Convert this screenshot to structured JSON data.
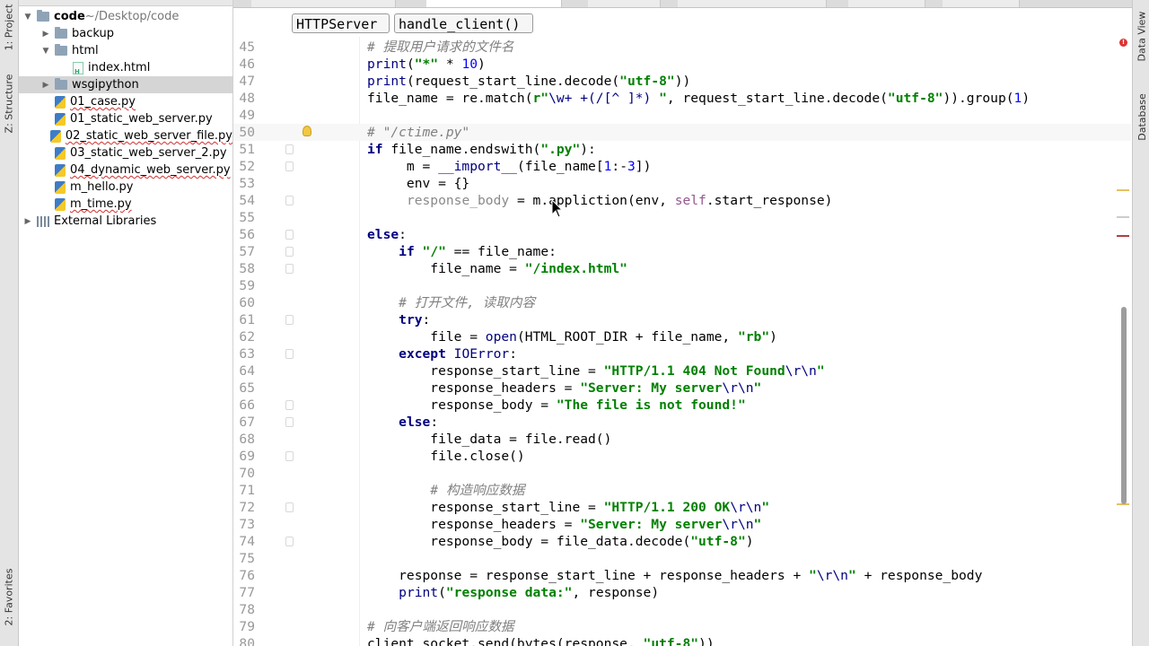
{
  "left_strip": {
    "project_tab": "1: Project",
    "structure_tab": "Z: Structure",
    "favorites_tab": "2: Favorites"
  },
  "right_strip": {
    "data_view_tab": "Data View",
    "database_tab": "Database"
  },
  "project_tree": [
    {
      "label": "code",
      "suffix": " ~/Desktop/code",
      "kind": "folder",
      "depth": 0,
      "expanded": true
    },
    {
      "label": "backup",
      "kind": "folder",
      "depth": 1,
      "expanded": false
    },
    {
      "label": "html",
      "kind": "folder",
      "depth": 1,
      "expanded": true
    },
    {
      "label": "index.html",
      "kind": "html",
      "depth": 2
    },
    {
      "label": "wsgipython",
      "kind": "folder",
      "depth": 1,
      "expanded": false,
      "selected": true
    },
    {
      "label": "01_case.py",
      "kind": "py",
      "depth": 1,
      "error": true
    },
    {
      "label": "01_static_web_server.py",
      "kind": "py",
      "depth": 1,
      "error": false
    },
    {
      "label": "02_static_web_server_file.py",
      "kind": "py",
      "depth": 1,
      "error": true
    },
    {
      "label": "03_static_web_server_2.py",
      "kind": "py",
      "depth": 1,
      "error": false
    },
    {
      "label": "04_dynamic_web_server.py",
      "kind": "py",
      "depth": 1,
      "error": true
    },
    {
      "label": "m_hello.py",
      "kind": "py",
      "depth": 1,
      "error": false
    },
    {
      "label": "m_time.py",
      "kind": "py",
      "depth": 1,
      "error": true
    },
    {
      "label": "External Libraries",
      "kind": "lib",
      "depth": 0,
      "expanded": false
    }
  ],
  "breadcrumb": {
    "class_name": "HTTPServer",
    "method_name": "handle_client()"
  },
  "code_lines": [
    {
      "n": "45",
      "html": "<span class='c-cm'># 提取用户请求的文件名</span>"
    },
    {
      "n": "46",
      "html": "<span class='c-bi'>print</span>(<span class='c-str'>\"*\"</span> * <span class='c-num'>10</span>)"
    },
    {
      "n": "47",
      "html": "<span class='c-bi'>print</span>(request_start_line.decode(<span class='c-str'>\"utf-8\"</span>))"
    },
    {
      "n": "48",
      "html": "file_name = re.match(<span class='c-str'>r\"</span><span class='c-esc'>\\w+ +(/[^ ]*) </span><span class='c-str'>\"</span>, request_start_line.decode(<span class='c-str'>\"utf-8\"</span>)).group(<span class='c-num'>1</span>)"
    },
    {
      "n": "49",
      "html": ""
    },
    {
      "n": "50",
      "html": "<span class='c-cm'># \"/ctime.py\"</span>",
      "current": true
    },
    {
      "n": "51",
      "html": "<span class='c-kw'>if</span> file_name.endswith(<span class='c-str'>\".py\"</span>):"
    },
    {
      "n": "52",
      "html": "     m = <span class='c-bi'>__import__</span>(file_name[<span class='c-num'>1</span>:-<span class='c-num'>3</span>])"
    },
    {
      "n": "53",
      "html": "     env = {}"
    },
    {
      "n": "54",
      "html": "     <span class='c-dim'>response_body</span> = m.appliction(env, <span class='c-self'>self</span>.start_response)"
    },
    {
      "n": "55",
      "html": ""
    },
    {
      "n": "56",
      "html": "<span class='c-kw'>else</span>:"
    },
    {
      "n": "57",
      "html": "    <span class='c-kw'>if</span> <span class='c-str'>\"/\"</span> == file_name:"
    },
    {
      "n": "58",
      "html": "        file_name = <span class='c-str'>\"/index.html\"</span>"
    },
    {
      "n": "59",
      "html": ""
    },
    {
      "n": "60",
      "html": "    <span class='c-cm'># 打开文件, 读取内容</span>"
    },
    {
      "n": "61",
      "html": "    <span class='c-kw'>try</span>:"
    },
    {
      "n": "62",
      "html": "        file = <span class='c-bi'>open</span>(HTML_ROOT_DIR + file_name, <span class='c-str'>\"rb\"</span>)"
    },
    {
      "n": "63",
      "html": "    <span class='c-kw'>except</span> <span class='c-bi'>IOError</span>:"
    },
    {
      "n": "64",
      "html": "        response_start_line = <span class='c-str'>\"HTTP/1.1 404 Not Found</span><span class='c-esc'>\\r\\n</span><span class='c-str'>\"</span>"
    },
    {
      "n": "65",
      "html": "        response_headers = <span class='c-str'>\"Server: My server</span><span class='c-esc'>\\r\\n</span><span class='c-str'>\"</span>"
    },
    {
      "n": "66",
      "html": "        response_body = <span class='c-str'>\"The file is not found!\"</span>"
    },
    {
      "n": "67",
      "html": "    <span class='c-kw'>else</span>:"
    },
    {
      "n": "68",
      "html": "        file_data = file.read()"
    },
    {
      "n": "69",
      "html": "        file.close()"
    },
    {
      "n": "70",
      "html": ""
    },
    {
      "n": "71",
      "html": "        <span class='c-cm'># 构造响应数据</span>"
    },
    {
      "n": "72",
      "html": "        response_start_line = <span class='c-str'>\"HTTP/1.1 200 OK</span><span class='c-esc'>\\r\\n</span><span class='c-str'>\"</span>"
    },
    {
      "n": "73",
      "html": "        response_headers = <span class='c-str'>\"Server: My server</span><span class='c-esc'>\\r\\n</span><span class='c-str'>\"</span>"
    },
    {
      "n": "74",
      "html": "        response_body = file_data.decode(<span class='c-str'>\"utf-8\"</span>)"
    },
    {
      "n": "75",
      "html": ""
    },
    {
      "n": "76",
      "html": "    response = response_start_line + response_headers + <span class='c-str'>\"</span><span class='c-esc'>\\r\\n</span><span class='c-str'>\"</span> + response_body"
    },
    {
      "n": "77",
      "html": "    <span class='c-bi'>print</span>(<span class='c-str'>\"response data:\"</span>, response)"
    },
    {
      "n": "78",
      "html": ""
    },
    {
      "n": "79",
      "html": "<span class='c-cm'># 向客户端返回响应数据</span>"
    },
    {
      "n": "80",
      "html": "client_socket.send(bytes(response, <span class='c-str'>\"utf-8\"</span>))"
    }
  ],
  "colors": {
    "keyword": "#000080",
    "string": "#008000",
    "comment": "#808080",
    "number": "#0000ff",
    "self": "#94558d",
    "selection": "#d5d5d5"
  }
}
